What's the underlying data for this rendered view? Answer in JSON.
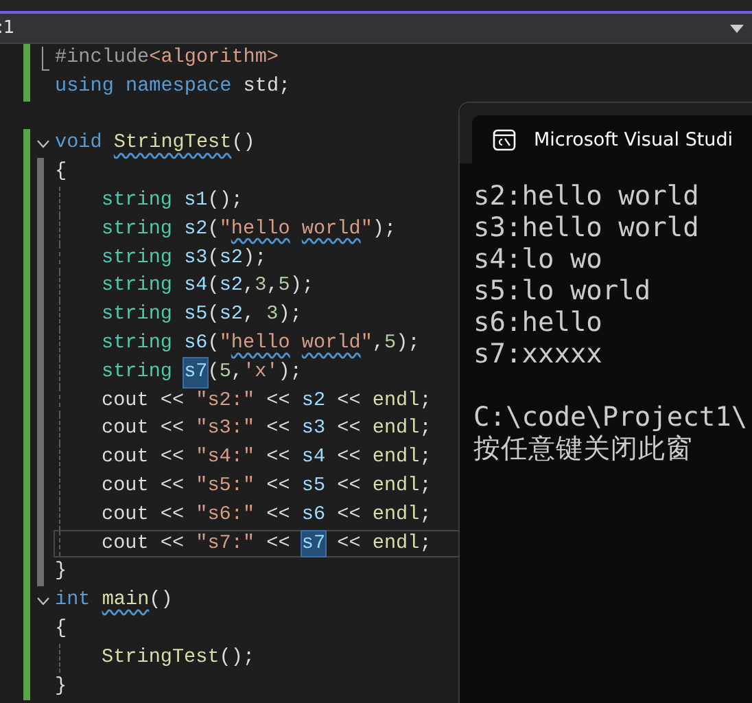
{
  "nav_bar": {
    "label": ":1"
  },
  "editor": {
    "lines": [
      {
        "changed": true,
        "scope": false,
        "current": false,
        "foldable": false,
        "region_marker": true,
        "indented": false,
        "tokens": [
          {
            "text": "#include",
            "kind": "directive"
          },
          {
            "text": "<algorithm>",
            "kind": "string"
          }
        ]
      },
      {
        "changed": true,
        "scope": false,
        "current": false,
        "foldable": false,
        "region_marker": false,
        "indented": false,
        "tokens": [
          {
            "text": "using ",
            "kind": "keyword"
          },
          {
            "text": "namespace",
            "kind": "keyword"
          },
          {
            "text": " std;",
            "kind": "plain"
          }
        ]
      },
      {
        "changed": false,
        "scope": false,
        "current": false,
        "foldable": false,
        "region_marker": false,
        "indented": false
      },
      {
        "changed": true,
        "scope": false,
        "current": false,
        "foldable": true,
        "region_marker": false,
        "indented": false,
        "tokens": [
          {
            "text": "void ",
            "kind": "keyword"
          },
          {
            "text": "StringTest",
            "kind": "func-squiggle"
          },
          {
            "text": "()",
            "kind": "plain"
          }
        ]
      },
      {
        "changed": true,
        "scope": true,
        "current": false,
        "foldable": false,
        "region_marker": false,
        "indented": false,
        "tokens": [
          {
            "text": "{",
            "kind": "plain"
          }
        ]
      },
      {
        "changed": true,
        "scope": true,
        "current": false,
        "foldable": false,
        "region_marker": false,
        "indented": true,
        "tokens": [
          {
            "text": "string ",
            "kind": "type"
          },
          {
            "text": "s1",
            "kind": "var"
          },
          {
            "text": "();",
            "kind": "plain"
          }
        ]
      },
      {
        "changed": true,
        "scope": true,
        "current": false,
        "foldable": false,
        "region_marker": false,
        "indented": true,
        "tokens": [
          {
            "text": "string ",
            "kind": "type"
          },
          {
            "text": "s2",
            "kind": "var"
          },
          {
            "text": "(",
            "kind": "plain"
          },
          {
            "text": "\"",
            "kind": "string"
          },
          {
            "text": "hello world",
            "kind": "string-squiggle"
          },
          {
            "text": "\"",
            "kind": "string"
          },
          {
            "text": ");",
            "kind": "plain"
          }
        ]
      },
      {
        "changed": true,
        "scope": true,
        "current": false,
        "foldable": false,
        "region_marker": false,
        "indented": true,
        "tokens": [
          {
            "text": "string ",
            "kind": "type"
          },
          {
            "text": "s3",
            "kind": "var"
          },
          {
            "text": "(",
            "kind": "plain"
          },
          {
            "text": "s2",
            "kind": "var"
          },
          {
            "text": ");",
            "kind": "plain"
          }
        ]
      },
      {
        "changed": true,
        "scope": true,
        "current": false,
        "foldable": false,
        "region_marker": false,
        "indented": true,
        "tokens": [
          {
            "text": "string ",
            "kind": "type"
          },
          {
            "text": "s4",
            "kind": "var"
          },
          {
            "text": "(",
            "kind": "plain"
          },
          {
            "text": "s2",
            "kind": "var"
          },
          {
            "text": ",",
            "kind": "plain"
          },
          {
            "text": "3",
            "kind": "number"
          },
          {
            "text": ",",
            "kind": "plain"
          },
          {
            "text": "5",
            "kind": "number"
          },
          {
            "text": ");",
            "kind": "plain"
          }
        ]
      },
      {
        "changed": true,
        "scope": true,
        "current": false,
        "foldable": false,
        "region_marker": false,
        "indented": true,
        "tokens": [
          {
            "text": "string ",
            "kind": "type"
          },
          {
            "text": "s5",
            "kind": "var"
          },
          {
            "text": "(",
            "kind": "plain"
          },
          {
            "text": "s2",
            "kind": "var"
          },
          {
            "text": ", ",
            "kind": "plain"
          },
          {
            "text": "3",
            "kind": "number"
          },
          {
            "text": ");",
            "kind": "plain"
          }
        ]
      },
      {
        "changed": true,
        "scope": true,
        "current": false,
        "foldable": false,
        "region_marker": false,
        "indented": true,
        "tokens": [
          {
            "text": "string ",
            "kind": "type"
          },
          {
            "text": "s6",
            "kind": "var"
          },
          {
            "text": "(",
            "kind": "plain"
          },
          {
            "text": "\"",
            "kind": "string"
          },
          {
            "text": "hello world",
            "kind": "string-squiggle"
          },
          {
            "text": "\"",
            "kind": "string"
          },
          {
            "text": ",",
            "kind": "plain"
          },
          {
            "text": "5",
            "kind": "number"
          },
          {
            "text": ");",
            "kind": "plain"
          }
        ]
      },
      {
        "changed": true,
        "scope": true,
        "current": false,
        "foldable": false,
        "region_marker": false,
        "indented": true,
        "tokens": [
          {
            "text": "string ",
            "kind": "type"
          },
          {
            "text": "s7",
            "kind": "var-selected"
          },
          {
            "text": "(",
            "kind": "plain"
          },
          {
            "text": "5",
            "kind": "number"
          },
          {
            "text": ",",
            "kind": "plain"
          },
          {
            "text": "'x'",
            "kind": "string"
          },
          {
            "text": ");",
            "kind": "plain"
          }
        ]
      },
      {
        "changed": true,
        "scope": true,
        "current": false,
        "foldable": false,
        "region_marker": false,
        "indented": true,
        "tokens": [
          {
            "text": "cout << ",
            "kind": "plain"
          },
          {
            "text": "\"s2:\"",
            "kind": "string"
          },
          {
            "text": " << ",
            "kind": "plain"
          },
          {
            "text": "s2",
            "kind": "var"
          },
          {
            "text": " << ",
            "kind": "plain"
          },
          {
            "text": "endl",
            "kind": "func"
          },
          {
            "text": ";",
            "kind": "plain"
          }
        ]
      },
      {
        "changed": true,
        "scope": true,
        "current": false,
        "foldable": false,
        "region_marker": false,
        "indented": true,
        "tokens": [
          {
            "text": "cout << ",
            "kind": "plain"
          },
          {
            "text": "\"s3:\"",
            "kind": "string"
          },
          {
            "text": " << ",
            "kind": "plain"
          },
          {
            "text": "s3",
            "kind": "var"
          },
          {
            "text": " << ",
            "kind": "plain"
          },
          {
            "text": "endl",
            "kind": "func"
          },
          {
            "text": ";",
            "kind": "plain"
          }
        ]
      },
      {
        "changed": true,
        "scope": true,
        "current": false,
        "foldable": false,
        "region_marker": false,
        "indented": true,
        "tokens": [
          {
            "text": "cout << ",
            "kind": "plain"
          },
          {
            "text": "\"s4:\"",
            "kind": "string"
          },
          {
            "text": " << ",
            "kind": "plain"
          },
          {
            "text": "s4",
            "kind": "var"
          },
          {
            "text": " << ",
            "kind": "plain"
          },
          {
            "text": "endl",
            "kind": "func"
          },
          {
            "text": ";",
            "kind": "plain"
          }
        ]
      },
      {
        "changed": true,
        "scope": true,
        "current": false,
        "foldable": false,
        "region_marker": false,
        "indented": true,
        "tokens": [
          {
            "text": "cout << ",
            "kind": "plain"
          },
          {
            "text": "\"s5:\"",
            "kind": "string"
          },
          {
            "text": " << ",
            "kind": "plain"
          },
          {
            "text": "s5",
            "kind": "var"
          },
          {
            "text": " << ",
            "kind": "plain"
          },
          {
            "text": "endl",
            "kind": "func"
          },
          {
            "text": ";",
            "kind": "plain"
          }
        ]
      },
      {
        "changed": true,
        "scope": true,
        "current": false,
        "foldable": false,
        "region_marker": false,
        "indented": true,
        "tokens": [
          {
            "text": "cout << ",
            "kind": "plain"
          },
          {
            "text": "\"s6:\"",
            "kind": "string"
          },
          {
            "text": " << ",
            "kind": "plain"
          },
          {
            "text": "s6",
            "kind": "var"
          },
          {
            "text": " << ",
            "kind": "plain"
          },
          {
            "text": "endl",
            "kind": "func"
          },
          {
            "text": ";",
            "kind": "plain"
          }
        ]
      },
      {
        "changed": true,
        "scope": true,
        "current": true,
        "foldable": false,
        "region_marker": false,
        "indented": true,
        "tokens": [
          {
            "text": "cout << ",
            "kind": "plain"
          },
          {
            "text": "\"s7:\"",
            "kind": "string"
          },
          {
            "text": " << ",
            "kind": "plain"
          },
          {
            "text": "s7",
            "kind": "var-selected"
          },
          {
            "text": " << ",
            "kind": "plain"
          },
          {
            "text": "endl",
            "kind": "func"
          },
          {
            "text": ";",
            "kind": "plain"
          }
        ]
      },
      {
        "changed": true,
        "scope": true,
        "current": false,
        "foldable": false,
        "region_marker": false,
        "indented": false,
        "tokens": [
          {
            "text": "}",
            "kind": "plain"
          }
        ]
      },
      {
        "changed": true,
        "scope": false,
        "current": false,
        "foldable": true,
        "region_marker": false,
        "indented": false,
        "tokens": [
          {
            "text": "int ",
            "kind": "keyword"
          },
          {
            "text": "main",
            "kind": "func-squiggle"
          },
          {
            "text": "()",
            "kind": "plain"
          }
        ]
      },
      {
        "changed": true,
        "scope": false,
        "current": false,
        "foldable": false,
        "region_marker": false,
        "indented": false,
        "tokens": [
          {
            "text": "{",
            "kind": "plain"
          }
        ]
      },
      {
        "changed": true,
        "scope": false,
        "current": false,
        "foldable": false,
        "region_marker": false,
        "indented": true,
        "tokens": [
          {
            "text": "StringTest",
            "kind": "func"
          },
          {
            "text": "();",
            "kind": "plain"
          }
        ]
      },
      {
        "changed": true,
        "scope": false,
        "current": false,
        "foldable": false,
        "region_marker": false,
        "indented": false,
        "tokens": [
          {
            "text": "}",
            "kind": "plain"
          }
        ]
      }
    ]
  },
  "console": {
    "title": "Microsoft Visual Studi",
    "lines": [
      "s2:hello world",
      "s3:hello world",
      "s4:lo wo",
      "s5:lo world",
      "s6:hello",
      "s7:xxxxx",
      "C:\\code\\Project1\\",
      "按任意键关闭此窗"
    ]
  }
}
